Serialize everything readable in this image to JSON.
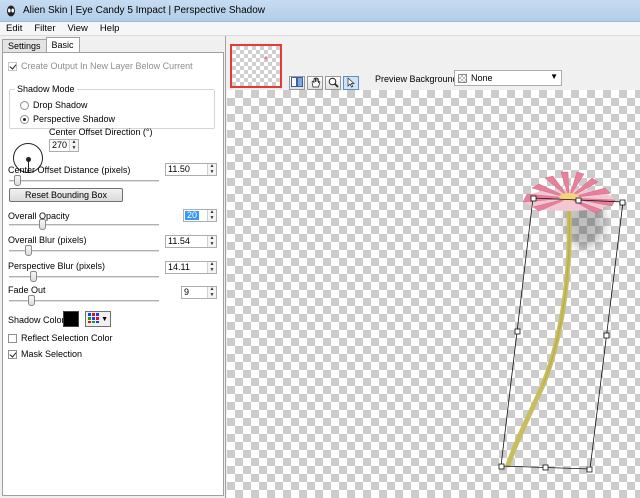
{
  "window": {
    "title": "Alien Skin | Eye Candy 5 Impact | Perspective Shadow"
  },
  "menu": [
    "Edit",
    "Filter",
    "View",
    "Help"
  ],
  "tabs": {
    "settings": "Settings",
    "basic": "Basic"
  },
  "basic": {
    "create_output_label": "Create Output In New Layer Below Current",
    "shadow_mode": {
      "title": "Shadow Mode",
      "options": [
        "Drop Shadow",
        "Perspective Shadow"
      ],
      "selected": "Perspective Shadow"
    },
    "center_offset_direction": {
      "label": "Center Offset Direction (°)",
      "value": "270"
    },
    "center_offset_distance": {
      "label": "Center Offset Distance (pixels)",
      "value": "11.50"
    },
    "reset_bounding_box": "Reset Bounding Box",
    "overall_opacity": {
      "label": "Overall Opacity",
      "value": "20"
    },
    "overall_blur": {
      "label": "Overall Blur (pixels)",
      "value": "11.54"
    },
    "perspective_blur": {
      "label": "Perspective Blur (pixels)",
      "value": "14.11"
    },
    "fade_out": {
      "label": "Fade Out",
      "value": "9"
    },
    "shadow_color": {
      "label": "Shadow Color",
      "value": "#000000"
    },
    "reflect_selection_color": {
      "label": "Reflect Selection Color",
      "checked": false
    },
    "mask_selection": {
      "label": "Mask Selection",
      "checked": true
    }
  },
  "preview": {
    "background_label": "Preview Background:",
    "background_value": "None",
    "tools": [
      "hand-icon",
      "zoom-icon",
      "arrow-icon"
    ]
  },
  "colors": {
    "thumbnail_border": "#e53935",
    "selection_highlight": "#3399ff",
    "flower_pink": "#e8809c",
    "stem_green": "#c8be60"
  }
}
